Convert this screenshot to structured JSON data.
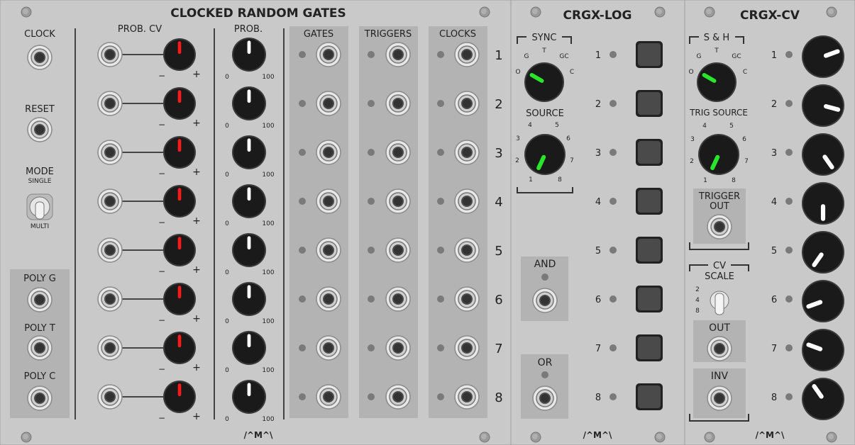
{
  "panel1": {
    "title": "CLOCKED RANDOM GATES",
    "logo": "/^M^\\",
    "labels": {
      "clock": "CLOCK",
      "reset": "RESET",
      "mode": "MODE",
      "single": "SINGLE",
      "multi": "MULTI",
      "poly_g": "POLY G",
      "poly_t": "POLY T",
      "poly_c": "POLY C",
      "prob_cv": "PROB. CV",
      "prob": "PROB.",
      "gates": "GATES",
      "triggers": "TRIGGERS",
      "clocks": "CLOCKS",
      "minus": "−",
      "plus": "+",
      "zero": "0",
      "hundred": "100"
    },
    "row_numbers": [
      "1",
      "2",
      "3",
      "4",
      "5",
      "6",
      "7",
      "8"
    ],
    "prob_cv_attenuverter_levels": [
      0,
      0,
      0,
      0,
      0,
      0,
      0,
      0
    ],
    "prob_levels": [
      0.5,
      0.5,
      0.5,
      0.5,
      0.5,
      0.5,
      0.5,
      0.5
    ]
  },
  "panel2": {
    "title": "CRGX-LOG",
    "logo": "/^M^\\",
    "labels": {
      "sync": "SYNC",
      "g": "G",
      "t": "T",
      "gc": "GC",
      "o": "O",
      "c": "C",
      "source": "SOURCE",
      "src_ticks": [
        "1",
        "2",
        "3",
        "4",
        "5",
        "6",
        "7",
        "8"
      ],
      "and": "AND",
      "or": "OR"
    },
    "sync_selected": "O",
    "source_selected": "1",
    "row_numbers": [
      "1",
      "2",
      "3",
      "4",
      "5",
      "6",
      "7",
      "8"
    ]
  },
  "panel3": {
    "title": "CRGX-CV",
    "logo": "/^M^\\",
    "labels": {
      "sh": "S & H",
      "g": "G",
      "t": "T",
      "gc": "GC",
      "o": "O",
      "c": "C",
      "trig_source": "TRIG SOURCE",
      "src_ticks": [
        "1",
        "2",
        "3",
        "4",
        "5",
        "6",
        "7",
        "8"
      ],
      "trigger": "TRIGGER",
      "out_word": "OUT",
      "cv": "CV",
      "scale": "SCALE",
      "scale_opts": [
        "2",
        "4",
        "8"
      ],
      "out": "OUT",
      "inv": "INV"
    },
    "sh_selected": "O",
    "trig_source_selected": "1",
    "scale_selected": "4",
    "row_numbers": [
      "1",
      "2",
      "3",
      "4",
      "5",
      "6",
      "7",
      "8"
    ],
    "cv_knob_angles": [
      70,
      105,
      145,
      180,
      215,
      250,
      290,
      325
    ]
  },
  "colors": {
    "panel": "#c9c9c9",
    "panel_dark": "#b3b3b3",
    "knob": "#1a1a1a",
    "pointer_red": "#ff1a1a",
    "pointer_green": "#2ae62a",
    "pointer_white": "#ffffff",
    "led_off": "#7a7a7a"
  }
}
